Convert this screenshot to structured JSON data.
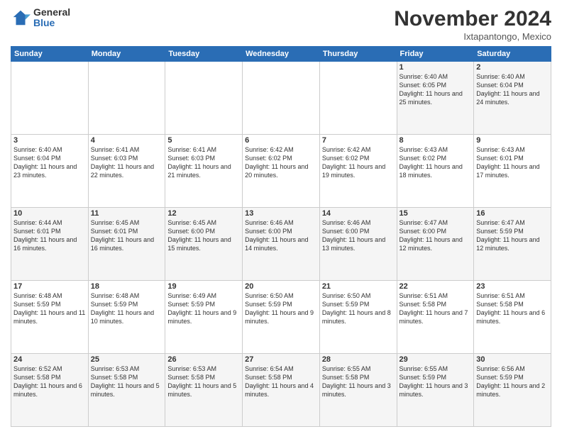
{
  "header": {
    "logo_general": "General",
    "logo_blue": "Blue",
    "month_title": "November 2024",
    "location": "Ixtapantongo, Mexico"
  },
  "calendar": {
    "days_of_week": [
      "Sunday",
      "Monday",
      "Tuesday",
      "Wednesday",
      "Thursday",
      "Friday",
      "Saturday"
    ],
    "weeks": [
      [
        {
          "day": "",
          "info": ""
        },
        {
          "day": "",
          "info": ""
        },
        {
          "day": "",
          "info": ""
        },
        {
          "day": "",
          "info": ""
        },
        {
          "day": "",
          "info": ""
        },
        {
          "day": "1",
          "info": "Sunrise: 6:40 AM\nSunset: 6:05 PM\nDaylight: 11 hours and 25 minutes."
        },
        {
          "day": "2",
          "info": "Sunrise: 6:40 AM\nSunset: 6:04 PM\nDaylight: 11 hours and 24 minutes."
        }
      ],
      [
        {
          "day": "3",
          "info": "Sunrise: 6:40 AM\nSunset: 6:04 PM\nDaylight: 11 hours and 23 minutes."
        },
        {
          "day": "4",
          "info": "Sunrise: 6:41 AM\nSunset: 6:03 PM\nDaylight: 11 hours and 22 minutes."
        },
        {
          "day": "5",
          "info": "Sunrise: 6:41 AM\nSunset: 6:03 PM\nDaylight: 11 hours and 21 minutes."
        },
        {
          "day": "6",
          "info": "Sunrise: 6:42 AM\nSunset: 6:02 PM\nDaylight: 11 hours and 20 minutes."
        },
        {
          "day": "7",
          "info": "Sunrise: 6:42 AM\nSunset: 6:02 PM\nDaylight: 11 hours and 19 minutes."
        },
        {
          "day": "8",
          "info": "Sunrise: 6:43 AM\nSunset: 6:02 PM\nDaylight: 11 hours and 18 minutes."
        },
        {
          "day": "9",
          "info": "Sunrise: 6:43 AM\nSunset: 6:01 PM\nDaylight: 11 hours and 17 minutes."
        }
      ],
      [
        {
          "day": "10",
          "info": "Sunrise: 6:44 AM\nSunset: 6:01 PM\nDaylight: 11 hours and 16 minutes."
        },
        {
          "day": "11",
          "info": "Sunrise: 6:45 AM\nSunset: 6:01 PM\nDaylight: 11 hours and 16 minutes."
        },
        {
          "day": "12",
          "info": "Sunrise: 6:45 AM\nSunset: 6:00 PM\nDaylight: 11 hours and 15 minutes."
        },
        {
          "day": "13",
          "info": "Sunrise: 6:46 AM\nSunset: 6:00 PM\nDaylight: 11 hours and 14 minutes."
        },
        {
          "day": "14",
          "info": "Sunrise: 6:46 AM\nSunset: 6:00 PM\nDaylight: 11 hours and 13 minutes."
        },
        {
          "day": "15",
          "info": "Sunrise: 6:47 AM\nSunset: 6:00 PM\nDaylight: 11 hours and 12 minutes."
        },
        {
          "day": "16",
          "info": "Sunrise: 6:47 AM\nSunset: 5:59 PM\nDaylight: 11 hours and 12 minutes."
        }
      ],
      [
        {
          "day": "17",
          "info": "Sunrise: 6:48 AM\nSunset: 5:59 PM\nDaylight: 11 hours and 11 minutes."
        },
        {
          "day": "18",
          "info": "Sunrise: 6:48 AM\nSunset: 5:59 PM\nDaylight: 11 hours and 10 minutes."
        },
        {
          "day": "19",
          "info": "Sunrise: 6:49 AM\nSunset: 5:59 PM\nDaylight: 11 hours and 9 minutes."
        },
        {
          "day": "20",
          "info": "Sunrise: 6:50 AM\nSunset: 5:59 PM\nDaylight: 11 hours and 9 minutes."
        },
        {
          "day": "21",
          "info": "Sunrise: 6:50 AM\nSunset: 5:59 PM\nDaylight: 11 hours and 8 minutes."
        },
        {
          "day": "22",
          "info": "Sunrise: 6:51 AM\nSunset: 5:58 PM\nDaylight: 11 hours and 7 minutes."
        },
        {
          "day": "23",
          "info": "Sunrise: 6:51 AM\nSunset: 5:58 PM\nDaylight: 11 hours and 6 minutes."
        }
      ],
      [
        {
          "day": "24",
          "info": "Sunrise: 6:52 AM\nSunset: 5:58 PM\nDaylight: 11 hours and 6 minutes."
        },
        {
          "day": "25",
          "info": "Sunrise: 6:53 AM\nSunset: 5:58 PM\nDaylight: 11 hours and 5 minutes."
        },
        {
          "day": "26",
          "info": "Sunrise: 6:53 AM\nSunset: 5:58 PM\nDaylight: 11 hours and 5 minutes."
        },
        {
          "day": "27",
          "info": "Sunrise: 6:54 AM\nSunset: 5:58 PM\nDaylight: 11 hours and 4 minutes."
        },
        {
          "day": "28",
          "info": "Sunrise: 6:55 AM\nSunset: 5:58 PM\nDaylight: 11 hours and 3 minutes."
        },
        {
          "day": "29",
          "info": "Sunrise: 6:55 AM\nSunset: 5:59 PM\nDaylight: 11 hours and 3 minutes."
        },
        {
          "day": "30",
          "info": "Sunrise: 6:56 AM\nSunset: 5:59 PM\nDaylight: 11 hours and 2 minutes."
        }
      ]
    ]
  }
}
